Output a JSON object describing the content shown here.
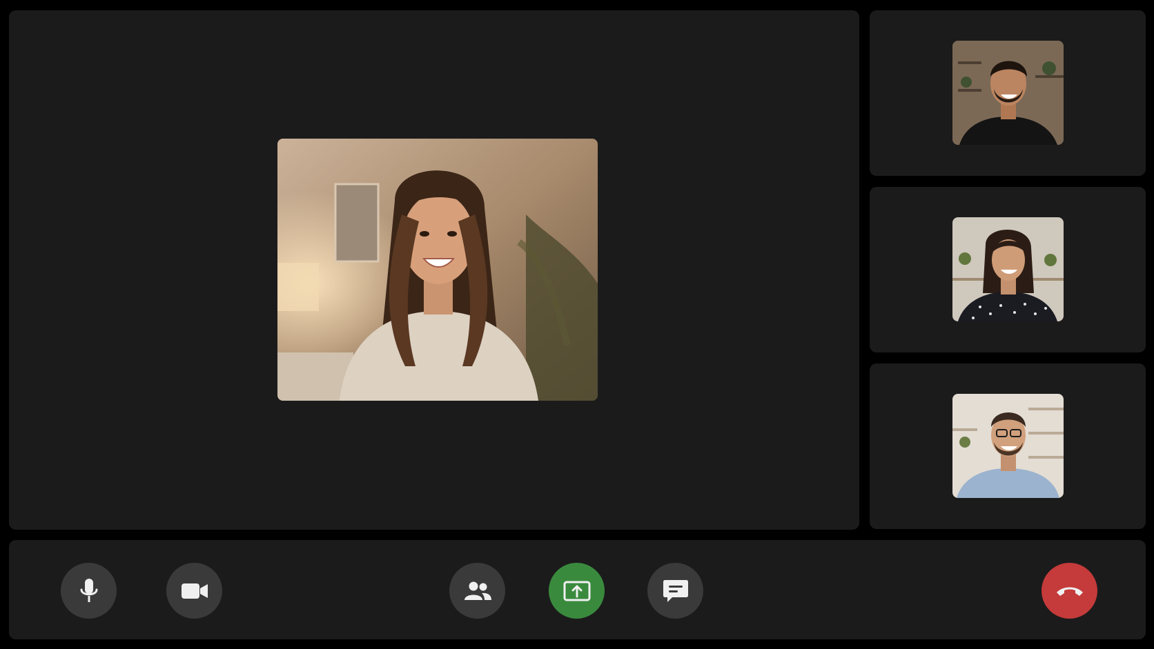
{
  "main_stage": {
    "active_speaker": {
      "avatar": "woman-long-wavy-hair-portrait"
    }
  },
  "participants": [
    {
      "avatar": "man-black-tshirt-portrait"
    },
    {
      "avatar": "woman-polka-dot-blouse-portrait"
    },
    {
      "avatar": "man-glasses-blue-shirt-portrait"
    }
  ],
  "controls": {
    "mic": {
      "icon": "microphone-icon"
    },
    "camera": {
      "icon": "video-camera-icon"
    },
    "participants": {
      "icon": "people-icon"
    },
    "share_screen": {
      "icon": "share-screen-icon",
      "color": "#3a8a3e"
    },
    "chat": {
      "icon": "chat-bubble-icon"
    },
    "end_call": {
      "icon": "phone-hangup-icon",
      "color": "#c53a3a"
    }
  },
  "colors": {
    "background": "#000000",
    "panel": "#1b1b1b",
    "control_button": "#3a3a3a",
    "icon": "#f0f0f0"
  }
}
